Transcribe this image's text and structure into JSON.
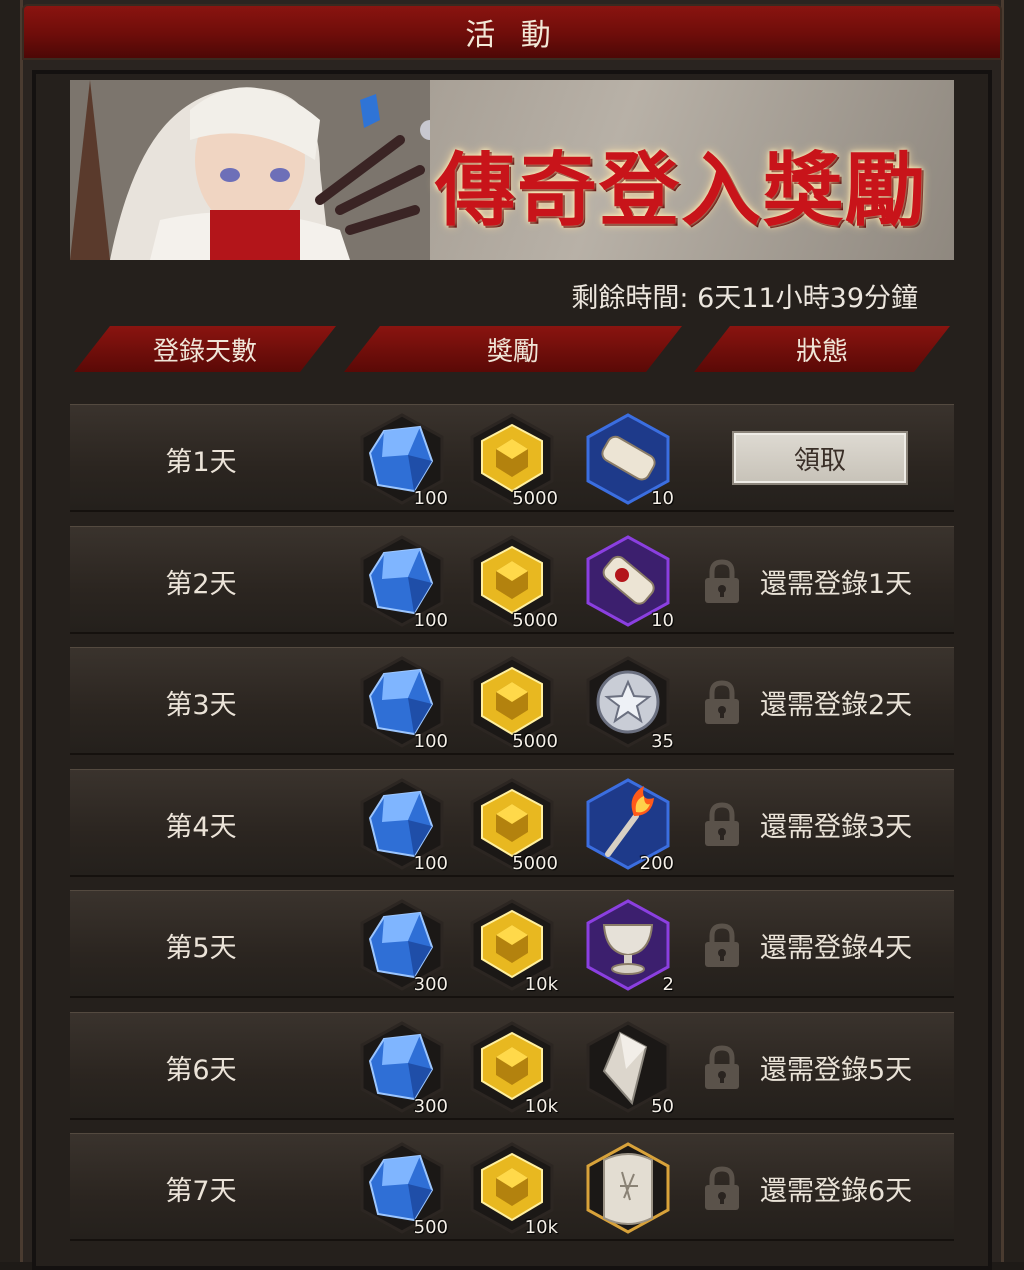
{
  "header": {
    "title": "活 動"
  },
  "banner": {
    "title": "傳奇登入獎勵"
  },
  "timer": "剩餘時間: 6天11小時39分鐘",
  "columns": {
    "days": "登錄天數",
    "rewards": "獎勵",
    "status": "狀態"
  },
  "colors": {
    "accent_red": "#8a1410",
    "gem_blue": "#2f6fd6",
    "gem_gold": "#e8b820"
  },
  "rows": [
    {
      "day": "第1天",
      "gem": "100",
      "gold": "5000",
      "item_icon": "scroll-icon",
      "item_count": "10",
      "status": "領取",
      "claimable": true
    },
    {
      "day": "第2天",
      "gem": "100",
      "gold": "5000",
      "item_icon": "sealed-scroll-icon",
      "item_count": "10",
      "status": "還需登錄1天",
      "claimable": false
    },
    {
      "day": "第3天",
      "gem": "100",
      "gold": "5000",
      "item_icon": "star-coin-icon",
      "item_count": "35",
      "status": "還需登錄2天",
      "claimable": false
    },
    {
      "day": "第4天",
      "gem": "100",
      "gold": "5000",
      "item_icon": "torch-icon",
      "item_count": "200",
      "status": "還需登錄3天",
      "claimable": false
    },
    {
      "day": "第5天",
      "gem": "300",
      "gold": "10k",
      "item_icon": "chalice-icon",
      "item_count": "2",
      "status": "還需登錄4天",
      "claimable": false
    },
    {
      "day": "第6天",
      "gem": "300",
      "gold": "10k",
      "item_icon": "crystal-shard-icon",
      "item_count": "50",
      "status": "還需登錄5天",
      "claimable": false
    },
    {
      "day": "第7天",
      "gem": "500",
      "gold": "10k",
      "item_icon": "rune-tablet-icon",
      "item_count": "",
      "status": "還需登錄6天",
      "claimable": false
    }
  ]
}
